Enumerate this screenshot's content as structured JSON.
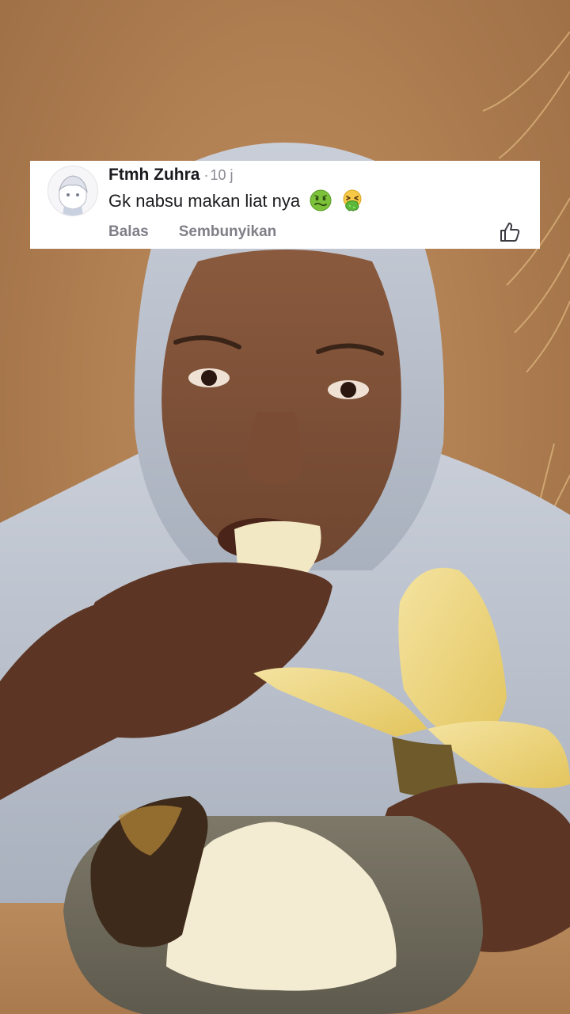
{
  "comment": {
    "author": "Ftmh Zuhra",
    "separator": "·",
    "time": "10 j",
    "text": "Gk nabsu makan liat nya",
    "emojis": [
      "nauseated-face-emoji",
      "vomiting-face-emoji"
    ],
    "actions": {
      "reply_label": "Balas",
      "hide_label": "Sembunyikan"
    },
    "like_icon": "thumbs-up-icon",
    "avatar_icon": "anime-avatar"
  },
  "video": {
    "description_icon": "video-frame"
  },
  "colors": {
    "card_background": "#ffffff",
    "author_text": "#1b1b1f",
    "meta_text": "#8a8a92",
    "action_text": "#7f7f88",
    "video_background": "#b07d52"
  }
}
